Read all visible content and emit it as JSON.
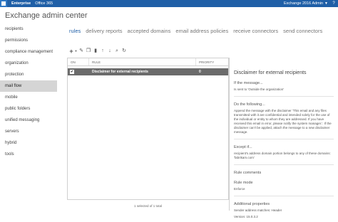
{
  "topbar": {
    "tabs": [
      "Enterprise",
      "Office 365"
    ],
    "user": "Exchange 2016 Admin",
    "help": "?"
  },
  "app_title": "Exchange admin center",
  "nav": [
    "recipients",
    "permissions",
    "compliance management",
    "organization",
    "protection",
    "mail flow",
    "mobile",
    "public folders",
    "unified messaging",
    "servers",
    "hybrid",
    "tools"
  ],
  "tabs": [
    "rules",
    "delivery reports",
    "accepted domains",
    "email address policies",
    "receive connectors",
    "send connectors"
  ],
  "toolbar": {
    "icons": [
      "plus-icon",
      "caret-down-icon",
      "edit-icon",
      "copy-icon",
      "delete-icon",
      "move-up-icon",
      "move-down-icon",
      "search-icon",
      "refresh-icon"
    ]
  },
  "grid": {
    "headers": {
      "on": "ON",
      "rule": "RULE",
      "priority": "PRIORITY"
    },
    "rows": [
      {
        "checked": "✔",
        "rule": "Disclaimer for external recipients",
        "priority": "0"
      }
    ]
  },
  "detail": {
    "title": "Disclaimer for external recipients",
    "if_label": "If the message...",
    "if_text": "Is sent to 'Outside the organization'",
    "do_label": "Do the following...",
    "do_lines": [
      "Append the message with the disclaimer 'This email and any files",
      "transmitted with it are confidential and intended solely for the use of",
      "the individual or entity to whom they are addressed. If you have",
      "received this email in error, please notify the system manager.'. If the",
      "disclaimer can't be applied, attach the message to a new disclaimer",
      "message."
    ],
    "except_label": "Except if...",
    "except_lines": [
      "recipient's address domain portion belongs to any of these domains:",
      "'fabrikam.com'"
    ],
    "comments_label": "Rule comments",
    "mode_label": "Rule mode",
    "mode_value": "Enforce",
    "props_label": "Additional properties",
    "props_value": "Sender address matches: Header",
    "version": "Version: 15.0.3.2"
  },
  "footer": "1 selected of 1 total"
}
